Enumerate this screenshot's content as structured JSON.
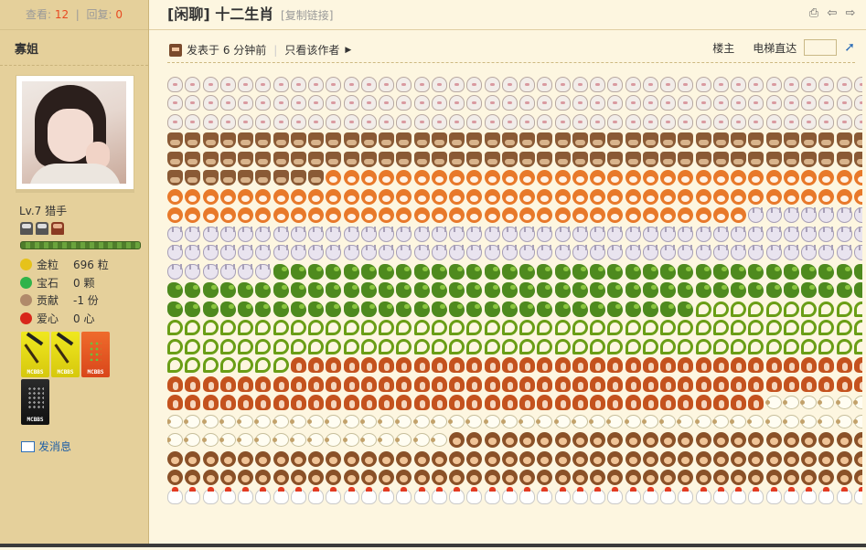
{
  "stats": {
    "views_label": "查看:",
    "views": "12",
    "replies_label": "回复:",
    "replies": "0"
  },
  "author": {
    "name": "寡姐",
    "level": "Lv.7 猎手"
  },
  "assets": [
    {
      "icon": "gold-nugget-icon",
      "label": "金粒",
      "value": "696 粒",
      "color": "#e6c21a"
    },
    {
      "icon": "gem-icon",
      "label": "宝石",
      "value": "0 颗",
      "color": "#2fb34a"
    },
    {
      "icon": "contribution-icon",
      "label": "贡献",
      "value": "-1 份",
      "color": "#b08a6a"
    },
    {
      "icon": "love-apple-icon",
      "label": "爱心",
      "value": "0 心",
      "color": "#d8261a"
    }
  ],
  "medals": [
    {
      "name": "medal-pickaxe-1",
      "style": "m-pick",
      "tag": "MCBBS"
    },
    {
      "name": "medal-pickaxe-2",
      "style": "m-pick",
      "tag": "MCBBS"
    },
    {
      "name": "medal-orange",
      "style": "m-orange",
      "tag": "MCBBS"
    },
    {
      "name": "medal-dark",
      "style": "m-dark",
      "tag": "MCBBS"
    }
  ],
  "send_message": "发消息",
  "thread": {
    "title": "[闲聊] 十二生肖",
    "copy_link": "[复制链接]"
  },
  "post": {
    "posted": "发表于 6 分钟前",
    "author_only": "只看该作者",
    "floor": "楼主",
    "jump": "电梯直达"
  },
  "content_rows": [
    [
      "rat",
      40
    ],
    [
      "rat",
      40
    ],
    [
      "rat",
      40
    ],
    [
      "ox",
      40
    ],
    [
      "ox",
      40
    ],
    [
      "ox",
      9,
      "tiger",
      31
    ],
    [
      "tiger",
      40
    ],
    [
      "tiger",
      33,
      "rabbit",
      7
    ],
    [
      "rabbit",
      40
    ],
    [
      "rabbit",
      40
    ],
    [
      "rabbit",
      6,
      "dragon",
      34
    ],
    [
      "dragon",
      40
    ],
    [
      "dragon",
      30,
      "snake",
      10
    ],
    [
      "snake",
      40
    ],
    [
      "snake",
      40
    ],
    [
      "snake",
      7,
      "horse",
      33
    ],
    [
      "horse",
      40
    ],
    [
      "horse",
      34,
      "sheep",
      6
    ],
    [
      "sheep",
      40
    ],
    [
      "sheep",
      16,
      "monkey",
      24
    ],
    [
      "monkey",
      40
    ],
    [
      "monkey",
      40
    ],
    [
      "rooster",
      40
    ]
  ]
}
